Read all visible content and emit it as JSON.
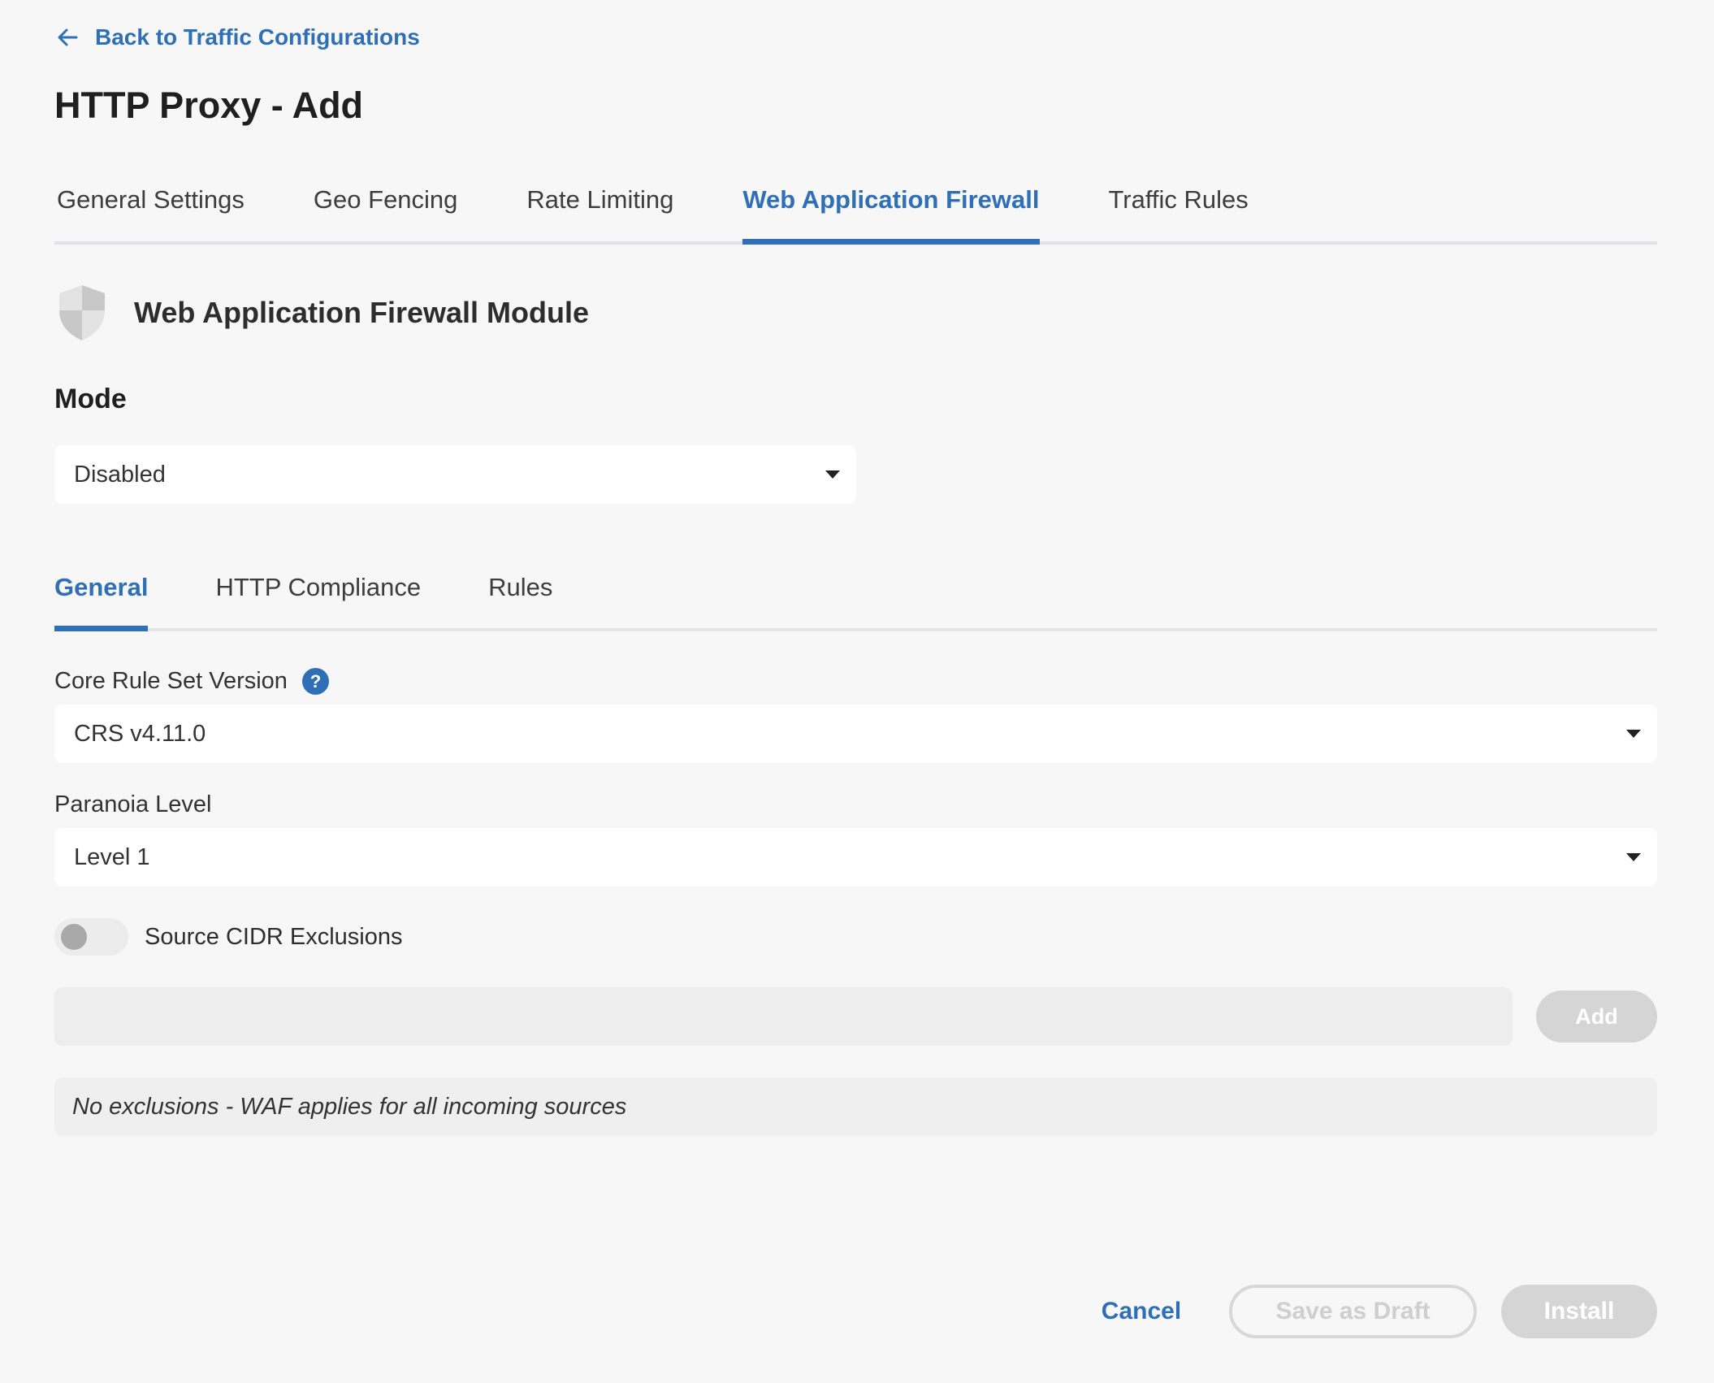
{
  "nav": {
    "back_label": "Back to Traffic Configurations"
  },
  "page": {
    "title": "HTTP Proxy - Add"
  },
  "main_tabs": [
    {
      "label": "General Settings",
      "active": false
    },
    {
      "label": "Geo Fencing",
      "active": false
    },
    {
      "label": "Rate Limiting",
      "active": false
    },
    {
      "label": "Web Application Firewall",
      "active": true
    },
    {
      "label": "Traffic Rules",
      "active": false
    }
  ],
  "module": {
    "icon": "shield-icon",
    "title": "Web Application Firewall Module"
  },
  "mode": {
    "label": "Mode",
    "value": "Disabled"
  },
  "sub_tabs": [
    {
      "label": "General",
      "active": true
    },
    {
      "label": "HTTP Compliance",
      "active": false
    },
    {
      "label": "Rules",
      "active": false
    }
  ],
  "general": {
    "crs": {
      "label": "Core Rule Set Version",
      "help": "?",
      "value": "CRS v4.11.0"
    },
    "paranoia": {
      "label": "Paranoia Level",
      "value": "Level 1"
    },
    "cidr_toggle": {
      "label": "Source CIDR Exclusions",
      "enabled": false
    },
    "cidr_input": {
      "value": "",
      "placeholder": ""
    },
    "add_label": "Add",
    "empty_message": "No exclusions - WAF applies for all incoming sources"
  },
  "footer": {
    "cancel_label": "Cancel",
    "draft_label": "Save as Draft",
    "install_label": "Install"
  },
  "colors": {
    "accent": "#2e6fb5",
    "background": "#f7f7f7",
    "disabled": "#d5d5d5"
  }
}
